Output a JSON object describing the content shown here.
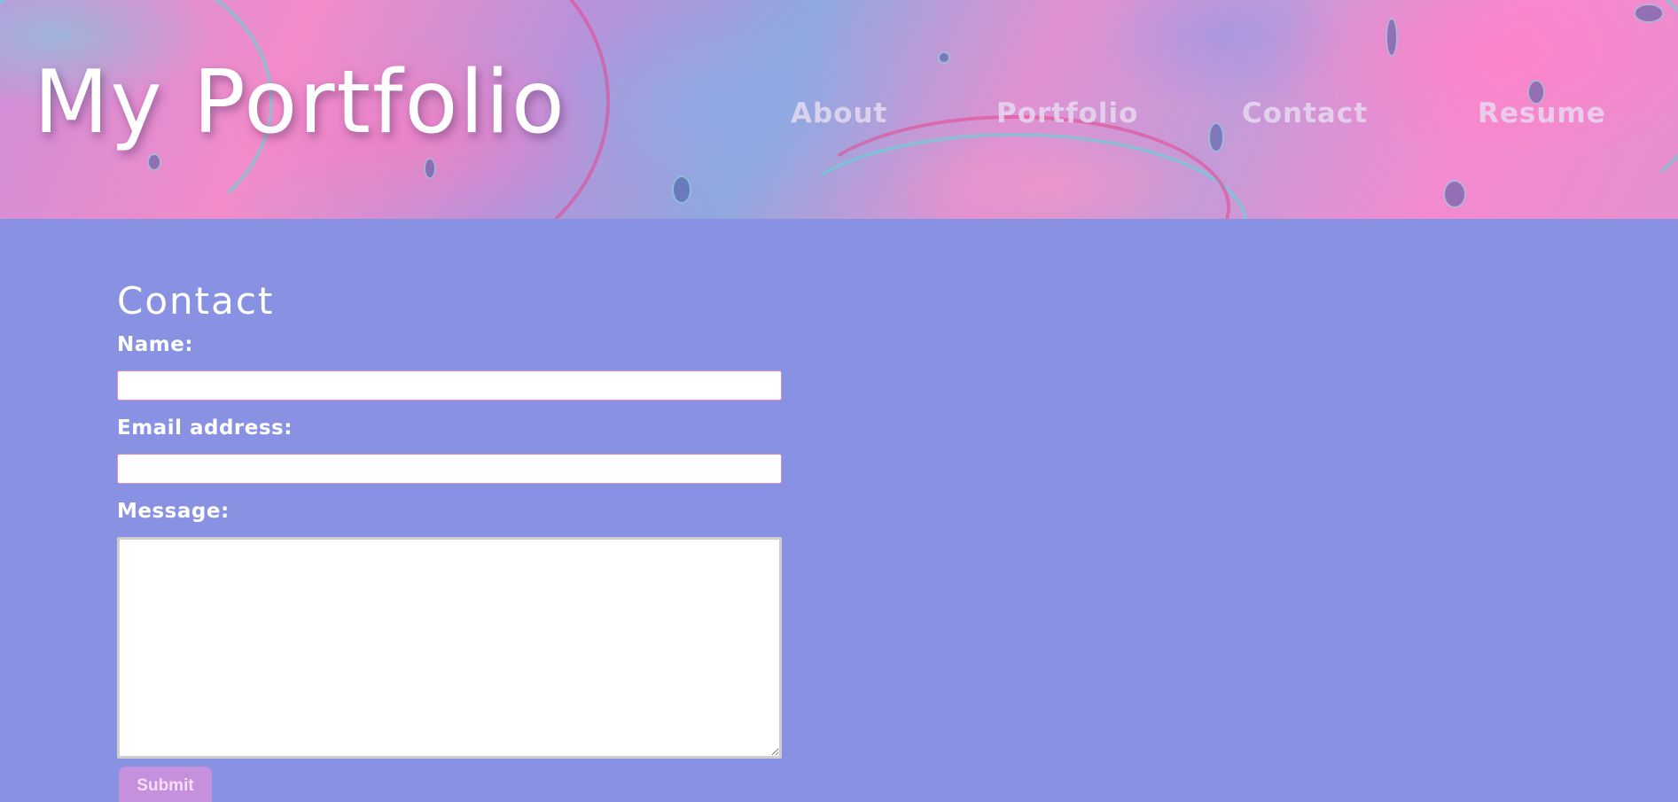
{
  "header": {
    "title": "My Portfolio",
    "nav": [
      "About",
      "Portfolio",
      "Contact",
      "Resume"
    ]
  },
  "contact": {
    "heading": "Contact",
    "name_label": "Name:",
    "name_value": "",
    "email_label": "Email address:",
    "email_value": "",
    "message_label": "Message:",
    "message_value": "",
    "submit_label": "Submit"
  },
  "colors": {
    "page_background": "#8891e2",
    "submit_background": "#c590dc",
    "input_border": "#e58ab9"
  }
}
